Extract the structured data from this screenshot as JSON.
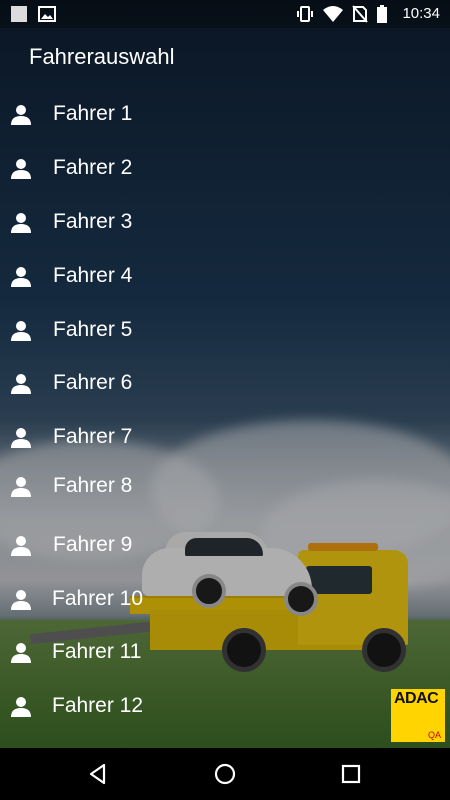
{
  "status_bar": {
    "time": "10:34",
    "left_icons": [
      "notification-square-icon",
      "image-icon"
    ],
    "right_icons": [
      "vibrate-icon",
      "wifi-icon",
      "no-sim-icon",
      "battery-icon"
    ]
  },
  "header": {
    "title": "Fahrerauswahl"
  },
  "drivers": [
    {
      "label": "Fahrer 1"
    },
    {
      "label": "Fahrer 2"
    },
    {
      "label": "Fahrer 3"
    },
    {
      "label": "Fahrer 4"
    },
    {
      "label": "Fahrer 5"
    },
    {
      "label": "Fahrer 6"
    },
    {
      "label": "Fahrer 7"
    },
    {
      "label": "Fahrer 8"
    },
    {
      "label": "Fahrer 9"
    },
    {
      "label": "Fahrer 10"
    },
    {
      "label": "Fahrer 11"
    },
    {
      "label": "Fahrer 12"
    }
  ],
  "logo": {
    "text": "ADAC",
    "subtext": "QA",
    "color": "#ffd400"
  },
  "nav_bar": {
    "icons": [
      "back-triangle-icon",
      "home-circle-icon",
      "recents-square-icon"
    ]
  },
  "colors": {
    "text": "#ffffff",
    "nav_background": "#000000"
  }
}
